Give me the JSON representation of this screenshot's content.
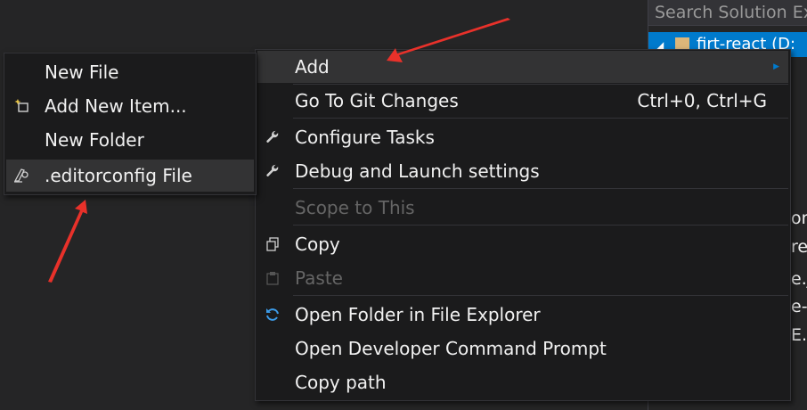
{
  "solution_explorer": {
    "search_placeholder": "Search Solution Ex",
    "root_label": "firt-react (D:",
    "fragments": [
      "on",
      "re",
      "e.js",
      "e-l",
      "E.m"
    ]
  },
  "context_menu": {
    "items": [
      {
        "label": "Add",
        "shortcut": "",
        "icon": "",
        "highlighted": true,
        "disabled": false,
        "submenu": true
      },
      {
        "label": "Go To Git Changes",
        "shortcut": "Ctrl+0, Ctrl+G",
        "icon": ""
      },
      {
        "label": "Configure Tasks",
        "shortcut": "",
        "icon": "wrench-icon"
      },
      {
        "label": "Debug and Launch settings",
        "shortcut": "",
        "icon": "wrench-icon"
      },
      {
        "label": "Scope to This",
        "shortcut": "",
        "icon": "",
        "disabled": true
      },
      {
        "label": "Copy",
        "shortcut": "",
        "icon": "copy-icon"
      },
      {
        "label": "Paste",
        "shortcut": "",
        "icon": "paste-icon",
        "disabled": true
      },
      {
        "label": "Open Folder in File Explorer",
        "shortcut": "",
        "icon": "refresh-icon"
      },
      {
        "label": "Open Developer Command Prompt",
        "shortcut": "",
        "icon": ""
      },
      {
        "label": "Copy path",
        "shortcut": "",
        "icon": ""
      }
    ]
  },
  "submenu": {
    "items": [
      {
        "label": "New File",
        "icon": ""
      },
      {
        "label": "Add New Item...",
        "icon": "new-item-icon"
      },
      {
        "label": "New Folder",
        "icon": ""
      },
      {
        "label": ".editorconfig File",
        "icon": "editorconfig-icon",
        "highlighted": true
      }
    ]
  },
  "colors": {
    "background": "#252526",
    "menu_bg": "#1b1b1c",
    "highlight": "#333334",
    "accent": "#007acc",
    "annotation_arrow": "#e8312a",
    "disabled_text": "#656565"
  }
}
